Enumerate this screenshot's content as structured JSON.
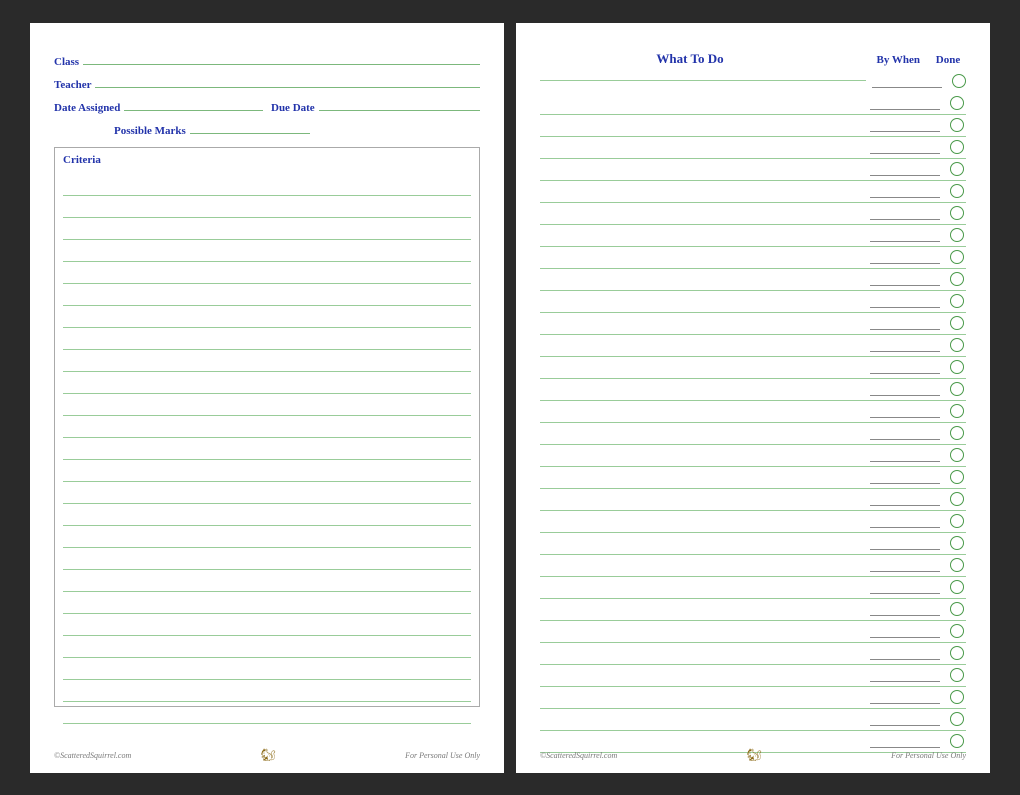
{
  "left_page": {
    "fields": {
      "class_label": "Class",
      "teacher_label": "Teacher",
      "date_assigned_label": "Date Assigned",
      "due_date_label": "Due Date",
      "possible_marks_label": "Possible Marks"
    },
    "criteria_label": "Criteria",
    "criteria_row_count": 25,
    "footer": {
      "copyright": "©ScatteredSquirrel.com",
      "personal_use": "For Personal Use Only",
      "squirrel": "🐿"
    }
  },
  "right_page": {
    "header": {
      "what_to_do": "What To Do",
      "by_when": "By When",
      "done": "Done"
    },
    "task_row_count": 30,
    "footer": {
      "copyright": "©ScatteredSquirrel.com",
      "personal_use": "For Personal Use Only",
      "squirrel": "🐿"
    }
  }
}
